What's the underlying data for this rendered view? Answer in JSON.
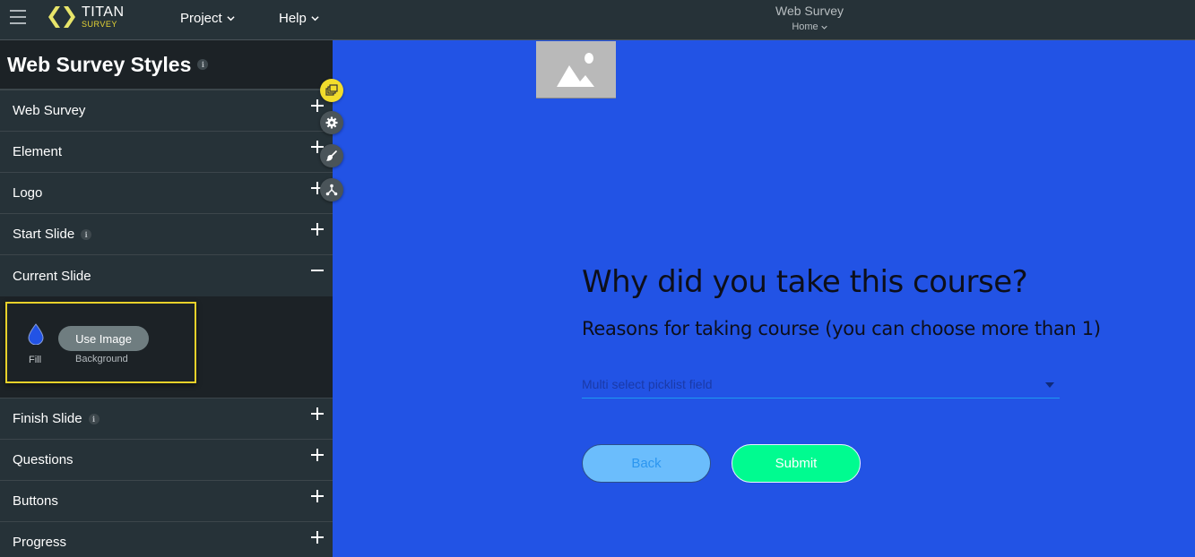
{
  "topbar": {
    "logo_title": "TITAN",
    "logo_subtitle": "SURVEY",
    "menus": [
      {
        "label": "Project"
      },
      {
        "label": "Help"
      }
    ],
    "app_title": "Web Survey",
    "page_selector": "Home"
  },
  "sidebar": {
    "title": "Web Survey Styles",
    "info_glyph": "i",
    "sections_top": [
      {
        "label": "Web Survey",
        "state": "collapsed"
      },
      {
        "label": "Element",
        "state": "collapsed"
      },
      {
        "label": "Logo",
        "state": "collapsed"
      },
      {
        "label": "Start Slide",
        "state": "collapsed",
        "info": true
      }
    ],
    "current_section": {
      "label": "Current Slide",
      "state": "expanded",
      "fill_label": "Fill",
      "fill_color": "#2253e5",
      "use_image_label": "Use Image",
      "background_label": "Background"
    },
    "sections_bottom": [
      {
        "label": "Finish Slide",
        "state": "collapsed",
        "info": true
      },
      {
        "label": "Questions",
        "state": "collapsed"
      },
      {
        "label": "Buttons",
        "state": "collapsed"
      },
      {
        "label": "Progress",
        "state": "collapsed"
      }
    ]
  },
  "tools": [
    {
      "icon": "layers-icon",
      "active": true
    },
    {
      "icon": "gear-icon",
      "active": false
    },
    {
      "icon": "brush-icon",
      "active": false
    },
    {
      "icon": "connection-icon",
      "active": false
    }
  ],
  "canvas": {
    "background_color": "#2253e5",
    "question": "Why did you take this course?",
    "subtitle": "Reasons for taking course (you can choose more than 1)",
    "picklist_placeholder": "Multi select picklist field",
    "back_label": "Back",
    "submit_label": "Submit"
  },
  "colors": {
    "topbar": "#263238",
    "accent_yellow": "#e8d12a",
    "submit_green": "#00fb90",
    "back_blue": "#6bbdfc"
  }
}
